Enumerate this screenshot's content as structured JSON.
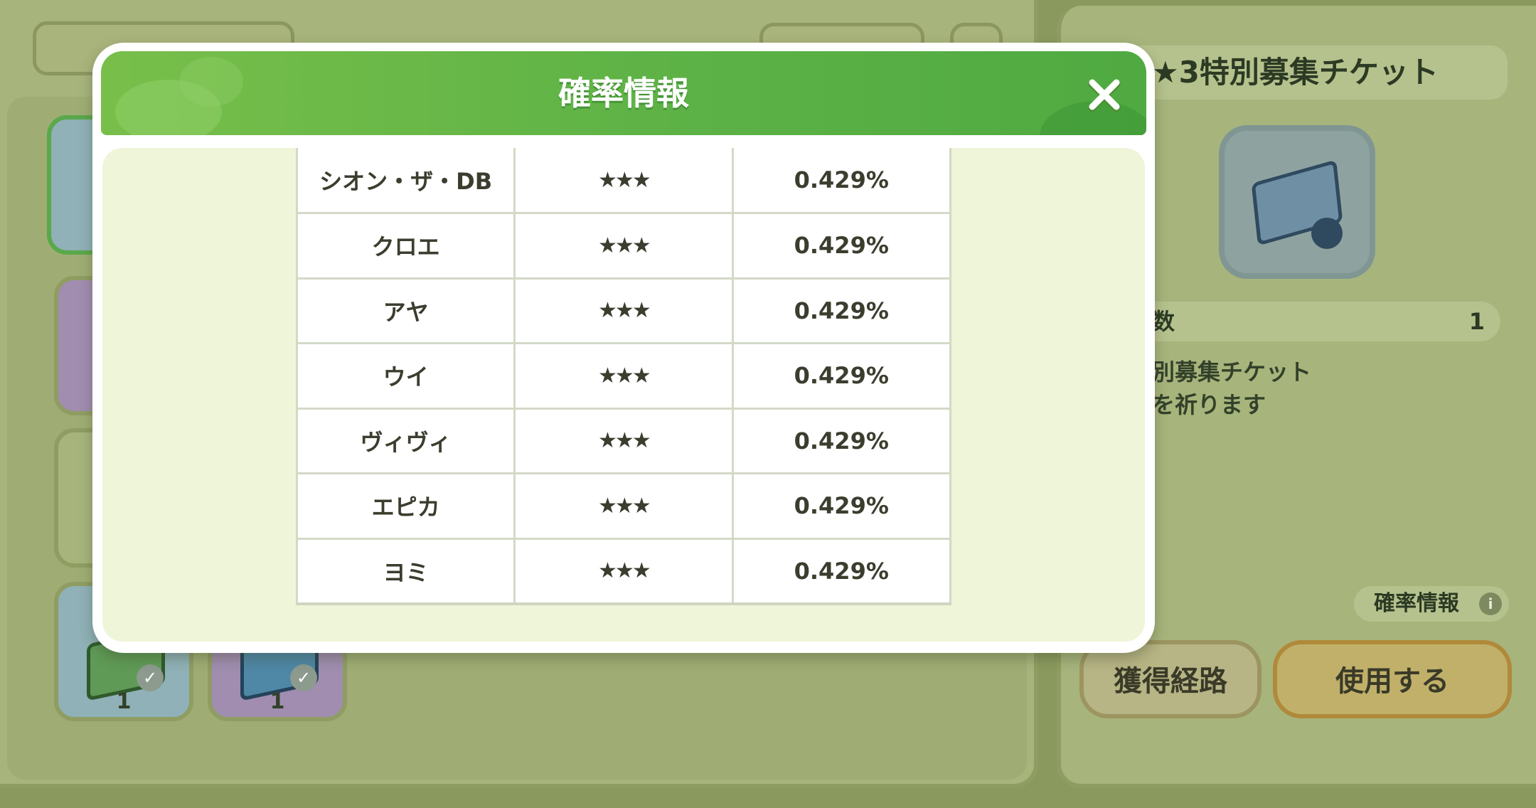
{
  "background": {
    "right_panel": {
      "ticket_title": "★3特別募集チケット",
      "owned_label": "数",
      "owned_value": "1",
      "description_line1": "別募集チケット",
      "description_line2": "を祈ります",
      "probability_chip": "確率情報",
      "info_icon_glyph": "i",
      "route_button": "獲得経路",
      "use_button": "使用する"
    },
    "left_panel": {
      "items": [
        {
          "count": "1",
          "color": "#8fb1b7"
        },
        {
          "count": "1",
          "color": "#a08db0"
        }
      ]
    }
  },
  "modal": {
    "title": "確率情報",
    "close_icon": "close-icon",
    "rows": [
      {
        "name": "シオン・ザ・DB",
        "rarity": "★★★",
        "rate": "0.429%"
      },
      {
        "name": "クロエ",
        "rarity": "★★★",
        "rate": "0.429%"
      },
      {
        "name": "アヤ",
        "rarity": "★★★",
        "rate": "0.429%"
      },
      {
        "name": "ウイ",
        "rarity": "★★★",
        "rate": "0.429%"
      },
      {
        "name": "ヴィヴィ",
        "rarity": "★★★",
        "rate": "0.429%"
      },
      {
        "name": "エピカ",
        "rarity": "★★★",
        "rate": "0.429%"
      },
      {
        "name": "ヨミ",
        "rarity": "★★★",
        "rate": "0.429%"
      }
    ]
  },
  "colors": {
    "header_green": "#5db246",
    "body_cream": "#eff5d9",
    "text_dark": "#3b3d2e"
  }
}
